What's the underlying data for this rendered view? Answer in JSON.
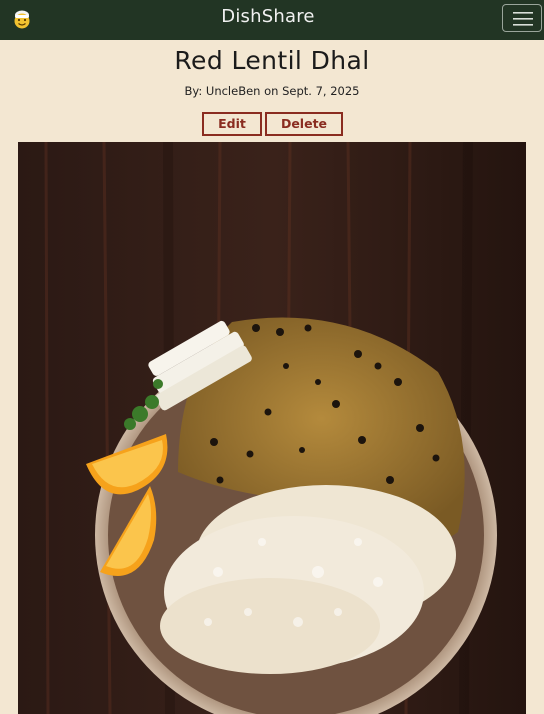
{
  "navbar": {
    "brand_icon": "chef-emoji-icon",
    "brand_name": "DishShare",
    "menu_icon": "hamburger-icon"
  },
  "recipe": {
    "title": "Red Lentil Dhal",
    "byline": "By: UncleBen on Sept. 7, 2025",
    "edit_label": "Edit",
    "delete_label": "Delete",
    "photo_subject": "dal-rice-plate-image"
  },
  "colors": {
    "navbar": "#223524",
    "page_background": "#f3e7d2",
    "button_accent": "#8a2c20"
  }
}
